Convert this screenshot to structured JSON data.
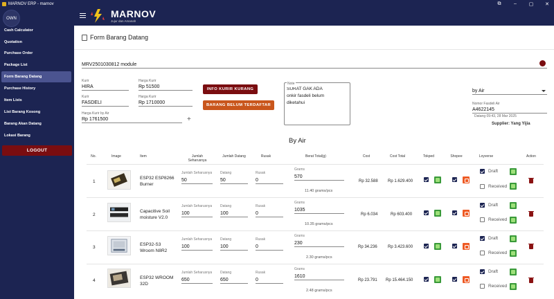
{
  "window": {
    "title": "MARNOV ERP - marnov"
  },
  "sidebar": {
    "avatar": "OWN",
    "items": [
      {
        "label": "Cash Calculator"
      },
      {
        "label": "Quotation"
      },
      {
        "label": "Purchase Order"
      },
      {
        "label": "Package List"
      },
      {
        "label": "Form Barang Datang",
        "active": true
      },
      {
        "label": "Purchase History"
      },
      {
        "label": "Item Lists"
      },
      {
        "label": "List Barang Kosong"
      },
      {
        "label": "Barang Akan Datang"
      },
      {
        "label": "Lokasi Barang"
      }
    ],
    "logout_label": "LOGOUT"
  },
  "header": {
    "brand": "MARNOV",
    "tagline": "Jujur dan Amanah"
  },
  "page": {
    "title": "Form Barang Datang",
    "po_select": "MRV2501030812 module",
    "kurir1": {
      "label": "Kurir",
      "value": "HIRA"
    },
    "harga_kurir1": {
      "label": "Harga Kurir",
      "value": "Rp 51500"
    },
    "kurir2": {
      "label": "Kurir",
      "value": "FASDELI"
    },
    "harga_kurir2": {
      "label": "Harga Kurir",
      "value": "Rp 1710000"
    },
    "harga_kurir_air": {
      "label": "Harga Kurir by Air",
      "value": "Rp 1761500"
    },
    "btn_info_kurir": "INFO KURIR KURANG",
    "btn_belum_terdaftar": "BARANG BELUM TERDAFTAR",
    "note": {
      "label": "Note",
      "lines": [
        "SURAT GAK ADA",
        "onkir fasdeli belum",
        "diketahui"
      ]
    },
    "shipping_method": "by Air",
    "nomor_fasdeli": {
      "label": "Nomor Fasdeli Air",
      "value": "A4622145"
    },
    "datang_time": "Datang 09:43, 28 Mar 2025",
    "supplier": "Supplier: Yang Yijia",
    "section_title": "By Air",
    "colors": {
      "navy": "#1c2452",
      "dark_red": "#7a0d10",
      "orange": "#c9561c"
    }
  },
  "table": {
    "headers": {
      "no": "No.",
      "image": "Image",
      "item": "Item",
      "jumlah_seharusnya": "Jumlah Seharusnya",
      "jumlah_datang": "Jumlah Datang",
      "rusak": "Rusak",
      "berat_total": "Berat Total(g)",
      "cost": "Cost",
      "cost_total": "Cost Total",
      "tokped": "Tokped",
      "shopee": "Shopee",
      "loyverse": "Loyverse",
      "action": "Action"
    },
    "field_labels": {
      "seharusnya": "Jumlah Seharusnya",
      "datang": "Datang",
      "rusak": "Rusak",
      "grams": "Grams"
    },
    "status_labels": {
      "draft": "Draft",
      "received": "Received"
    },
    "rows": [
      {
        "no": "1",
        "item": [
          "ESP32 ESP8266",
          "Burner"
        ],
        "seharusnya": "50",
        "datang": "50",
        "rusak": "0",
        "grams": "570",
        "per_pcs": "11.40 grams/pcs",
        "cost": "Rp 32.588",
        "cost_total": "Rp 1.629.400"
      },
      {
        "no": "2",
        "item": [
          "Capacitive Soil",
          "moisture V2.0"
        ],
        "seharusnya": "100",
        "datang": "100",
        "rusak": "0",
        "grams": "1035",
        "per_pcs": "10.35 grams/pcs",
        "cost": "Rp 6.034",
        "cost_total": "Rp 603.400"
      },
      {
        "no": "3",
        "item": [
          "ESP32-S3",
          "Wroom N8R2"
        ],
        "seharusnya": "100",
        "datang": "100",
        "rusak": "0",
        "grams": "230",
        "per_pcs": "2.30 grams/pcs",
        "cost": "Rp 34.236",
        "cost_total": "Rp 3.423.600"
      },
      {
        "no": "4",
        "item": [
          "ESP32 WROOM",
          "32D"
        ],
        "seharusnya": "650",
        "datang": "650",
        "rusak": "0",
        "grams": "1610",
        "per_pcs": "2.48 grams/pcs",
        "cost": "Rp 23.791",
        "cost_total": "Rp 15.464.150"
      }
    ]
  }
}
